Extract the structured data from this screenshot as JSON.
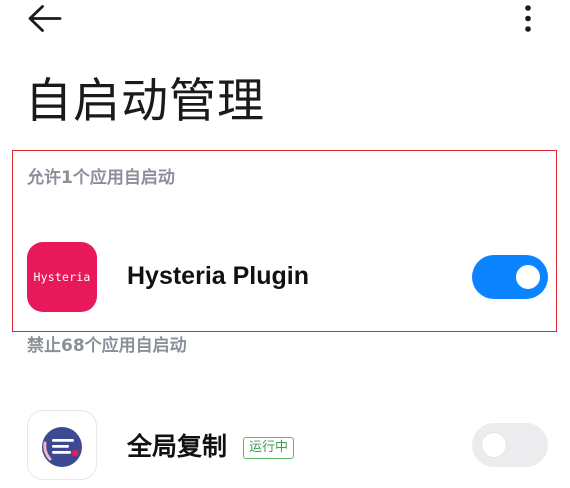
{
  "header": {
    "back_icon": "arrow-left-icon",
    "more_icon": "more-vertical-icon"
  },
  "page": {
    "title": "自启动管理"
  },
  "sections": {
    "allowed": {
      "label": "允许1个应用自启动",
      "apps": [
        {
          "name": "Hysteria Plugin",
          "icon": "hysteria-app-icon",
          "icon_text": "Hysteria",
          "icon_color": "#E8195A",
          "autostart_enabled": true
        }
      ]
    },
    "blocked": {
      "label": "禁止68个应用自启动",
      "apps": [
        {
          "name": "全局复制",
          "icon": "quanju-fuzhi-app-icon",
          "status_badge": "运行中",
          "autostart_enabled": false
        }
      ]
    }
  },
  "colors": {
    "accent": "#0D84FF",
    "highlight_border": "#E0282E",
    "badge_green": "#3F9C4F",
    "section_header": "#8A8F99"
  }
}
